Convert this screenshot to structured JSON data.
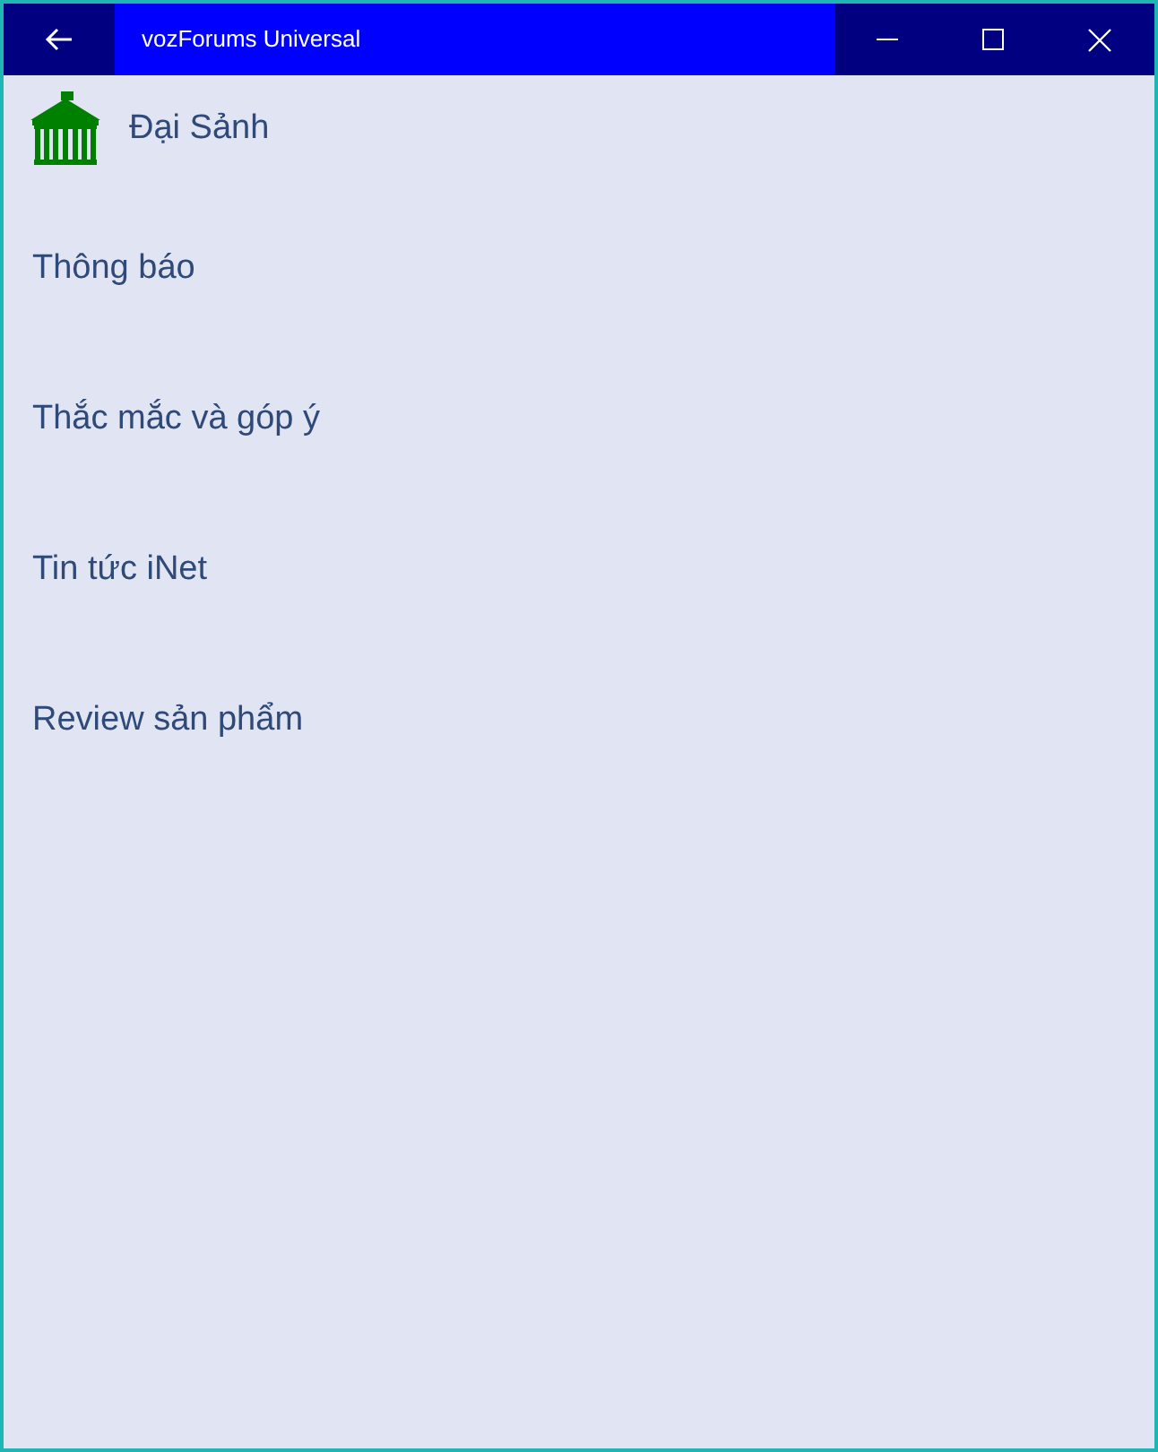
{
  "window": {
    "title": "vozForums Universal"
  },
  "header": {
    "title": "Đại Sảnh"
  },
  "items": [
    {
      "label": "Thông báo"
    },
    {
      "label": "Thắc mắc và góp ý"
    },
    {
      "label": "Tin tức iNet"
    },
    {
      "label": "Review sản phẩm"
    }
  ]
}
